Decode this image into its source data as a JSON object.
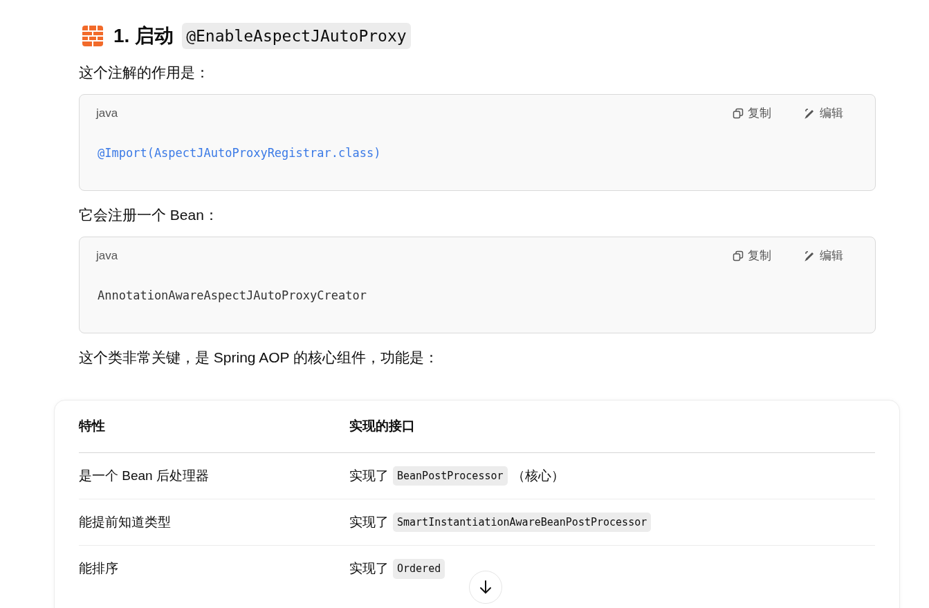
{
  "heading": {
    "number_title": "1. 启动",
    "code": "@EnableAspectJAutoProxy"
  },
  "blocks": [
    {
      "kind": "paragraph",
      "text": "这个注解的作用是："
    },
    {
      "kind": "code",
      "language": "java",
      "copy_label": "复制",
      "edit_label": "编辑",
      "syntax_highlighted": true,
      "code": "@Import(AspectJAutoProxyRegistrar.class)"
    },
    {
      "kind": "paragraph",
      "text": "它会注册一个 Bean："
    },
    {
      "kind": "code",
      "language": "java",
      "copy_label": "复制",
      "edit_label": "编辑",
      "syntax_highlighted": false,
      "code": "AnnotationAwareAspectJAutoProxyCreator"
    },
    {
      "kind": "paragraph",
      "text": "这个类非常关键，是 Spring AOP 的核心组件，功能是："
    }
  ],
  "table": {
    "columns": [
      "特性",
      "实现的接口"
    ],
    "rows": [
      {
        "feature": "是一个 Bean 后处理器",
        "interface": [
          {
            "kind": "text",
            "text": "实现了"
          },
          {
            "kind": "code",
            "text": "BeanPostProcessor"
          },
          {
            "kind": "text",
            "text": "（核心）"
          }
        ]
      },
      {
        "feature": "能提前知道类型",
        "interface": [
          {
            "kind": "text",
            "text": "实现了"
          },
          {
            "kind": "code",
            "text": "SmartInstantiationAwareBeanPostProcessor"
          }
        ]
      },
      {
        "feature": "能排序",
        "interface": [
          {
            "kind": "text",
            "text": "实现了"
          },
          {
            "kind": "code",
            "text": "Ordered"
          }
        ]
      }
    ]
  }
}
